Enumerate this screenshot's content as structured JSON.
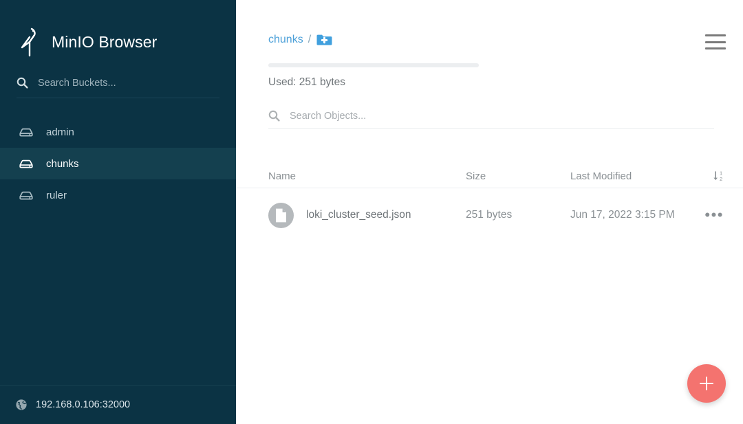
{
  "sidebar": {
    "brand": {
      "title": "MinIO Browser",
      "logo_icon": "minio-bird-logo"
    },
    "bucket_search": {
      "placeholder": "Search Buckets...",
      "value": "",
      "icon": "search-icon"
    },
    "buckets": [
      {
        "label": "admin",
        "icon": "bucket-drive-icon",
        "active": false
      },
      {
        "label": "chunks",
        "icon": "bucket-drive-icon",
        "active": true
      },
      {
        "label": "ruler",
        "icon": "bucket-drive-icon",
        "active": false
      }
    ],
    "footer": {
      "host": "192.168.0.106:32000",
      "icon": "globe-icon"
    }
  },
  "main": {
    "breadcrumb": {
      "bucket": "chunks",
      "separator": "/",
      "new_folder_icon": "folder-plus-icon"
    },
    "menu_icon": "hamburger-menu-icon",
    "usage": {
      "label": "Used: 251 bytes",
      "percent": 0
    },
    "object_search": {
      "placeholder": "Search Objects...",
      "value": "",
      "icon": "search-icon"
    },
    "table": {
      "columns": [
        "Name",
        "Size",
        "Last Modified"
      ],
      "sort_icon": "sort-descending-icon",
      "rows": [
        {
          "name": "loki_cluster_seed.json",
          "size": "251 bytes",
          "modified": "Jun 17, 2022 3:15 PM",
          "file_icon": "document-icon",
          "menu": "•••"
        }
      ]
    },
    "fab": {
      "icon": "plus-icon",
      "color": "#f4736f"
    }
  },
  "colors": {
    "sidebar_bg": "#0b3344",
    "sidebar_active": "#14404f",
    "accent_link": "#4a9fd8",
    "folder_blue": "#41a0de",
    "fab_red": "#f4736f",
    "text_muted": "#8a9094"
  }
}
